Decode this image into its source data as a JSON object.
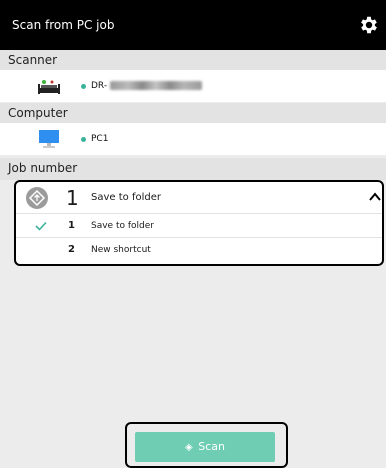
{
  "titlebar": {
    "title": "Scan from PC job",
    "settings_icon": "gear-icon"
  },
  "scanner": {
    "heading": "Scanner",
    "device_prefix": "DR-",
    "icon": "scanner-icon",
    "status_color": "#3bb39b"
  },
  "computer": {
    "heading": "Computer",
    "name": "PC1",
    "icon": "monitor-icon",
    "status_color": "#3bb39b"
  },
  "job": {
    "heading": "Job number",
    "selected": {
      "number": "1",
      "label": "Save to folder"
    },
    "items": [
      {
        "number": "1",
        "label": "Save to folder",
        "checked": true
      },
      {
        "number": "2",
        "label": "New shortcut",
        "checked": false
      }
    ]
  },
  "scan_button": {
    "label": "Scan",
    "color": "#6fcdb3"
  }
}
